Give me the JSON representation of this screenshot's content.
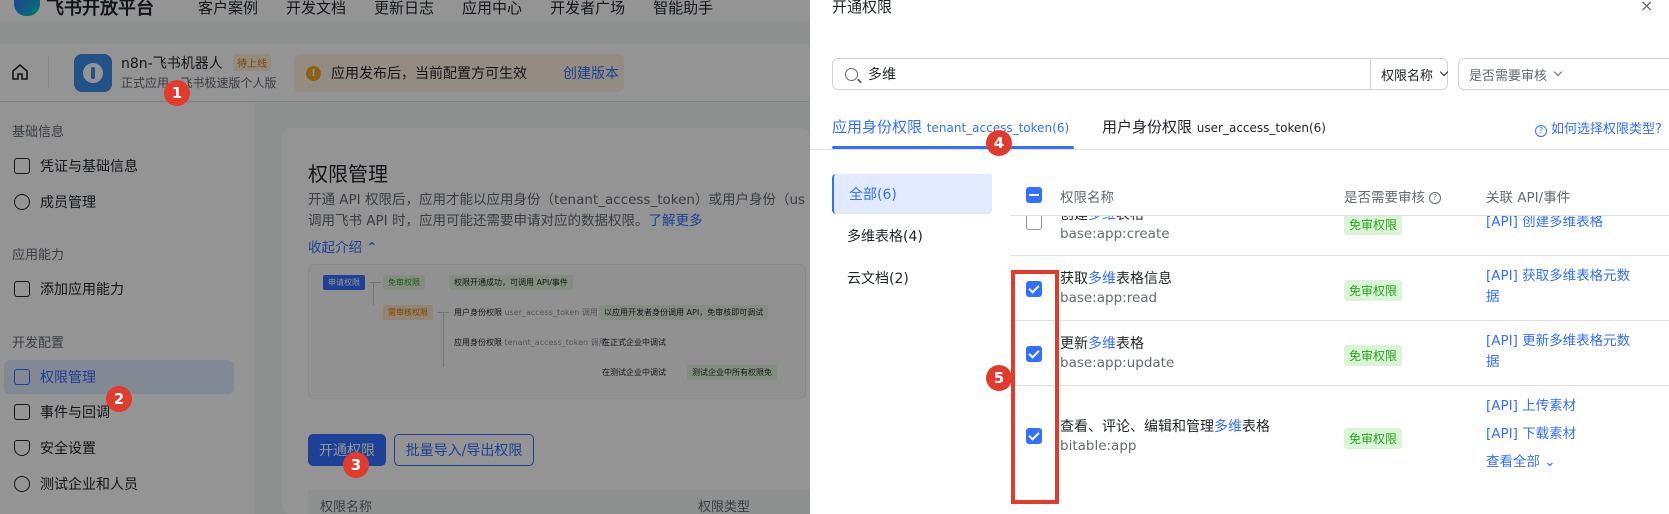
{
  "brand": {
    "name": "飞书开放平台"
  },
  "top_nav": [
    "客户案例",
    "开发文档",
    "更新日志",
    "应用中心",
    "开发者广场",
    "智能助手"
  ],
  "app": {
    "name": "n8n-飞书机器人",
    "badge": "待上线",
    "subtitle": "正式应用 · 飞书极速版个人版"
  },
  "notice": {
    "text": "应用发布后，当前配置方可生效",
    "link": "创建版本"
  },
  "sidebar": {
    "groups": [
      {
        "label": "基础信息",
        "items": [
          {
            "label": "凭证与基础信息",
            "icon": "card-icon"
          },
          {
            "label": "成员管理",
            "icon": "user-icon"
          }
        ]
      },
      {
        "label": "应用能力",
        "items": [
          {
            "label": "添加应用能力",
            "icon": "grid-icon"
          }
        ]
      },
      {
        "label": "开发配置",
        "items": [
          {
            "label": "权限管理",
            "icon": "lock-icon",
            "active": true
          },
          {
            "label": "事件与回调",
            "icon": "plus-box-icon"
          },
          {
            "label": "安全设置",
            "icon": "shield-icon"
          },
          {
            "label": "测试企业和人员",
            "icon": "people-icon"
          }
        ]
      }
    ]
  },
  "main": {
    "title": "权限管理",
    "desc_line1": "开通 API 权限后，应用才能以应用身份（tenant_access_token）或用户身份（us",
    "desc_line2": "调用飞书 API 时，应用可能还需要申请对应的数据权限。",
    "learn_more": "了解更多",
    "collapse": "收起介绍 ⌃",
    "flow": {
      "apply": "申请权限",
      "free": "免审权限",
      "free_result": "权限开通成功，可调用 API/事件",
      "review": "需审核权限",
      "user_identity": "用户身份权限",
      "user_identity_token": "user_access_token 调用",
      "user_identity_result": "以应用开发者身份调用 API，免审核即可调试",
      "app_identity": "应用身份权限",
      "app_identity_token": "tenant_access_token 调用",
      "formal_enterprise": "在正式企业中调试",
      "test_enterprise": "在测试企业中调试",
      "test_enterprise_result": "测试企业中所有权限免"
    },
    "open_btn": "开通权限",
    "batch_btn": "批量导入/导出权限",
    "table_col1": "权限名称",
    "table_col2": "权限类型"
  },
  "drawer": {
    "title": "开通权限",
    "close": "×",
    "search_value": "多维",
    "filter1": "权限名称",
    "filter2": "是否需要审核",
    "tab1": {
      "label": "应用身份权限",
      "token": "tenant_access_token(6)"
    },
    "tab2": {
      "label": "用户身份权限",
      "token": "user_access_token(6)"
    },
    "help": "如何选择权限类型?",
    "categories": [
      {
        "label": "全部(6)",
        "active": true
      },
      {
        "label": "多维表格(4)"
      },
      {
        "label": "云文档(2)"
      }
    ],
    "columns": {
      "name": "权限名称",
      "review": "是否需要审核",
      "api": "关联 API/事件"
    },
    "rows": [
      {
        "name_pre": "创建",
        "name_hl": "多维",
        "name_post": "表格",
        "code": "base:app:create",
        "tag": "免审权限",
        "api1": "[API] 创建多维表格",
        "api2": "",
        "checked": false
      },
      {
        "name_pre": "获取",
        "name_hl": "多维",
        "name_post": "表格信息",
        "code": "base:app:read",
        "tag": "免审权限",
        "api1": "[API] 获取多维表格元数",
        "api2": "据",
        "checked": true
      },
      {
        "name_pre": "更新",
        "name_hl": "多维",
        "name_post": "表格",
        "code": "base:app:update",
        "tag": "免审权限",
        "api1": "[API] 更新多维表格元数",
        "api2": "据",
        "checked": true
      },
      {
        "name_pre": "查看、评论、编辑和管理",
        "name_hl": "多维",
        "name_post": "表格",
        "code": "bitable:app",
        "tag": "免审权限",
        "api1": "[API] 上传素材",
        "api2": "[API] 下载素材",
        "api3": "查看全部 ⌄",
        "checked": true
      }
    ]
  },
  "annotations": [
    "1",
    "2",
    "3",
    "4",
    "5"
  ],
  "colors": {
    "accent": "#3370ff",
    "annotation": "#e03b2c",
    "tag_green": "#2ea121"
  }
}
